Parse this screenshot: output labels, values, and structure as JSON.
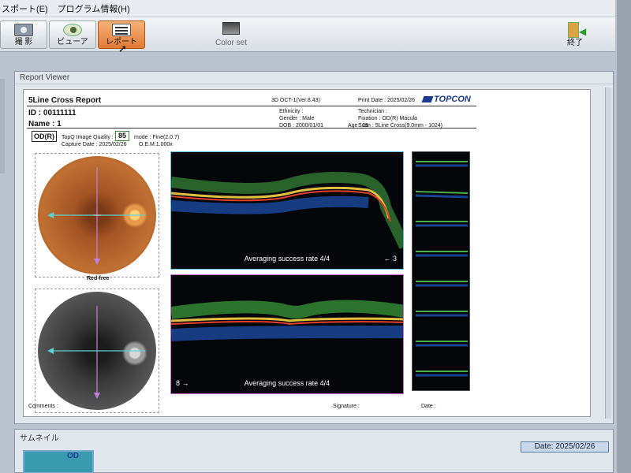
{
  "menubar": [
    "スポート(E)",
    "プログラム情報(H)"
  ],
  "toolbar": {
    "capture_label": "撮 影",
    "viewer_label": "ビューア",
    "report_label": "レポート",
    "colorset_label": "Color set",
    "exit_label": "終了"
  },
  "viewer": {
    "title": "Report Viewer"
  },
  "report": {
    "title": "5Line Cross Report",
    "id": "ID : 00111111",
    "name": "Name : 1",
    "version": "3D OCT-1(Ver.8.43)",
    "ethnicity": "Ethnicity :",
    "gender": "Gender : Male",
    "dob": "DOB : 2000/01/01",
    "age": "Age : 25",
    "print_date": "Print Date : 2025/02/26",
    "technician": "Technician :",
    "fixation": "Fixation : OD(R) Macula",
    "scan": "Scan : 5Line Cross(9.0mm - 1024)",
    "logo": "TOPCON",
    "eye": "OD(R)",
    "quality_label": "TopQ Image Quality :",
    "quality_value": "85",
    "mode": "mode : Fine(2.0.7)",
    "capture_date": "Capture Date : 2025/02/26",
    "oem": "O.E.M:1.000x",
    "redfree_label": "Red-free",
    "oct_top_caption": "Averaging success rate 4/4",
    "oct_top_arrow": "← 3",
    "oct_bottom_caption": "Averaging success rate 4/4",
    "oct_bottom_arrow": "8 →",
    "comments": "Comments :",
    "signature": "Signature :",
    "date_field": "Date :"
  },
  "thumbnails": {
    "title": "サムネイル",
    "badge": "OD",
    "date": "Date: 2025/02/26"
  },
  "icons": {
    "capture": "camera-icon",
    "viewer": "eye-icon",
    "report": "report-icon",
    "colorset": "color-set-icon",
    "exit": "exit-door-icon"
  }
}
